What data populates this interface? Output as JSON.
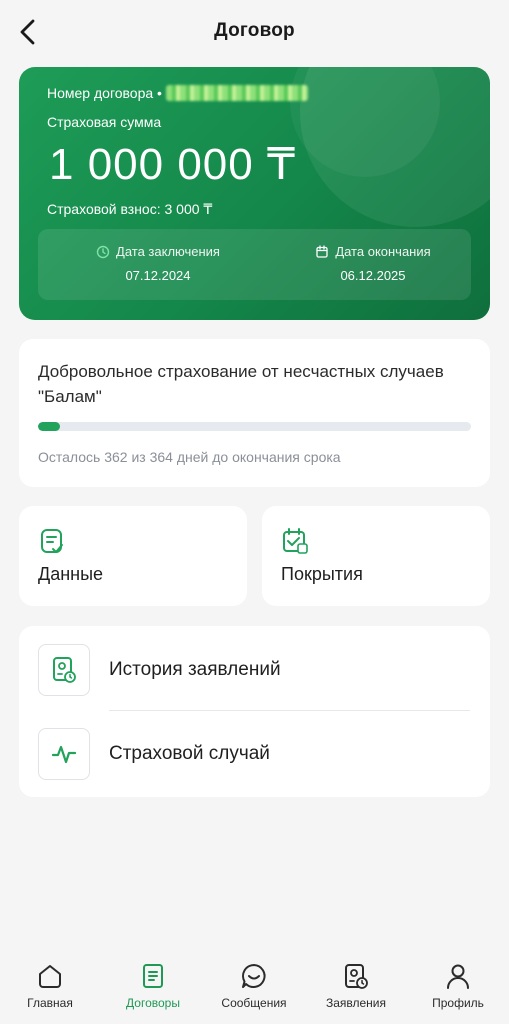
{
  "header": {
    "title": "Договор"
  },
  "contract": {
    "number_label": "Номер договора •",
    "sum_label": "Страховая сумма",
    "sum_value": "1 000 000 ₸",
    "premium": "Страховой взнос: 3 000 ₸",
    "start_label": "Дата заключения",
    "start_date": "07.12.2024",
    "end_label": "Дата окончания",
    "end_date": "06.12.2025"
  },
  "product": {
    "title": "Добровольное страхование от несчастных случаев \"Балам\"",
    "progress_fraction": 0.0055,
    "remaining_text": "Осталось 362 из 364 дней до окончания срока"
  },
  "tiles": {
    "data_label": "Данные",
    "coverage_label": "Покрытия"
  },
  "list": {
    "history_label": "История заявлений",
    "insurance_case_label": "Страховой случай"
  },
  "nav": {
    "home": "Главная",
    "contracts": "Договоры",
    "messages": "Сообщения",
    "applications": "Заявления",
    "profile": "Профиль"
  },
  "colors": {
    "accent": "#21a35b",
    "card_gradient_start": "#1e9c57",
    "card_gradient_end": "#0f6f3d",
    "background": "#f5f5f5"
  }
}
